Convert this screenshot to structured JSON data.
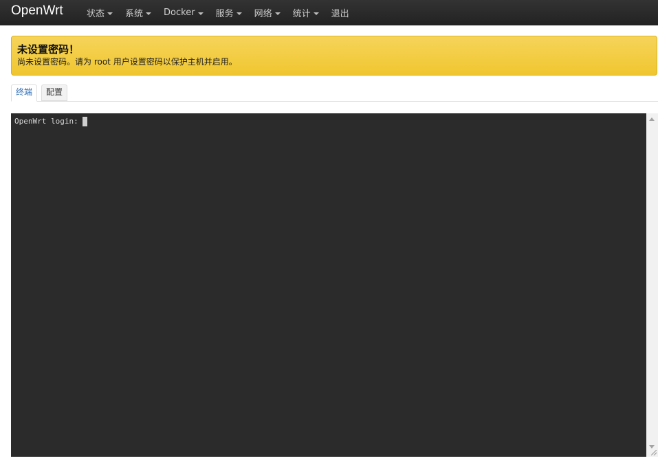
{
  "header": {
    "brand": "OpenWrt",
    "menu": [
      {
        "label": "状态",
        "has_dropdown": true
      },
      {
        "label": "系统",
        "has_dropdown": true
      },
      {
        "label": "Docker",
        "has_dropdown": true
      },
      {
        "label": "服务",
        "has_dropdown": true
      },
      {
        "label": "网络",
        "has_dropdown": true
      },
      {
        "label": "统计",
        "has_dropdown": true
      },
      {
        "label": "退出",
        "has_dropdown": false
      }
    ]
  },
  "alert": {
    "title": "未设置密码！",
    "message": "尚未设置密码。请为 root 用户设置密码以保护主机并启用。",
    "color": "#f0c62f"
  },
  "tabs": [
    {
      "label": "终端",
      "active": true
    },
    {
      "label": "配置",
      "active": false
    }
  ],
  "terminal": {
    "prompt": "OpenWrt login:",
    "background": "#2b2b2b"
  },
  "icons": [
    "caret-down-icon",
    "scroll-up-arrow-icon",
    "scroll-down-arrow-icon",
    "resize-grip-icon"
  ]
}
